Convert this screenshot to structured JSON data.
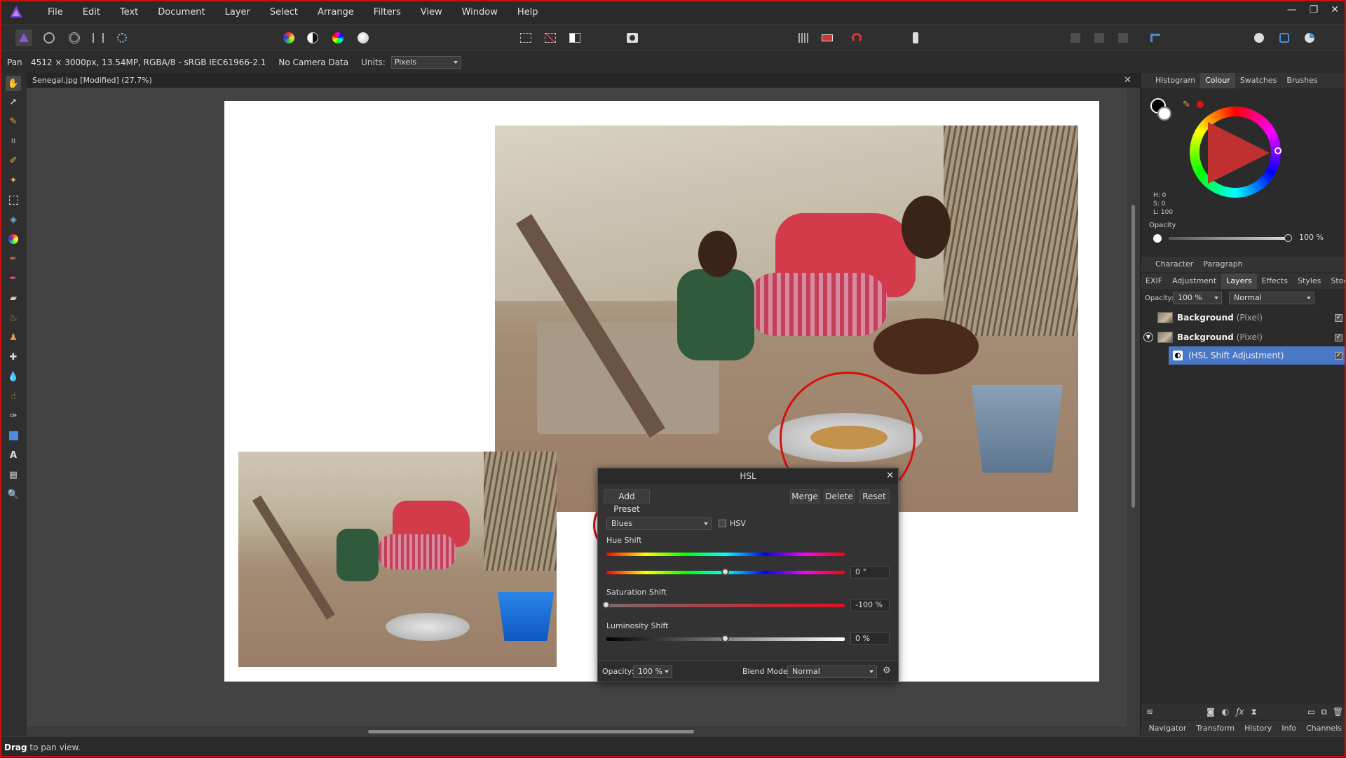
{
  "menu": [
    "File",
    "Edit",
    "Text",
    "Document",
    "Layer",
    "Select",
    "Arrange",
    "Filters",
    "View",
    "Window",
    "Help"
  ],
  "window_controls": [
    "—",
    "❐",
    "✕"
  ],
  "context": {
    "tool": "Pan",
    "doc_info": "4512 × 3000px, 13.54MP, RGBA/8 - sRGB IEC61966-2.1",
    "camera": "No Camera Data",
    "units_label": "Units:",
    "units_value": "Pixels"
  },
  "document_tab": "Senegal.jpg [Modified] (27.7%)",
  "hsl": {
    "title": "HSL",
    "add_preset": "Add Preset",
    "merge": "Merge",
    "delete": "Delete",
    "reset": "Reset",
    "range_value": "Blues",
    "hsv_label": "HSV",
    "hue_label": "Hue Shift",
    "hue_value": "0 °",
    "saturation_label": "Saturation Shift",
    "saturation_value": "-100 %",
    "luminosity_label": "Luminosity Shift",
    "luminosity_value": "0 %",
    "hue_level": 0.5,
    "saturation_level": 0.0,
    "luminosity_level": 0.5,
    "opacity_label": "Opacity:",
    "opacity_value": "100 %",
    "blend_label": "Blend Mode:",
    "blend_value": "Normal"
  },
  "panels": {
    "top_tabs": [
      "Histogram",
      "Colour",
      "Swatches",
      "Brushes"
    ],
    "top_active": "Colour",
    "hsl_readout": [
      "H: 0",
      "S: 0",
      "L: 100"
    ],
    "opacity_label": "Opacity",
    "opacity_value": "100 %",
    "char_tabs": [
      "Character",
      "Paragraph"
    ],
    "layer_tabs": [
      "EXIF",
      "Adjustment",
      "Layers",
      "Effects",
      "Styles",
      "Stock"
    ],
    "layer_active": "Layers",
    "layers_opacity_label": "Opacity:",
    "layers_opacity_value": "100 %",
    "layers_blend": "Normal",
    "layers": [
      {
        "name": "Background",
        "type": "(Pixel)"
      },
      {
        "name": "Background",
        "type": "(Pixel)"
      },
      {
        "name": "(HSL Shift Adjustment)",
        "type": ""
      }
    ],
    "bottom_tabs": [
      "Navigator",
      "Transform",
      "History",
      "Info",
      "Channels"
    ]
  },
  "status": {
    "bold": "Drag",
    "rest": " to pan view."
  },
  "colors": {
    "accent": "#4a78c8",
    "annotation": "#d31010"
  }
}
